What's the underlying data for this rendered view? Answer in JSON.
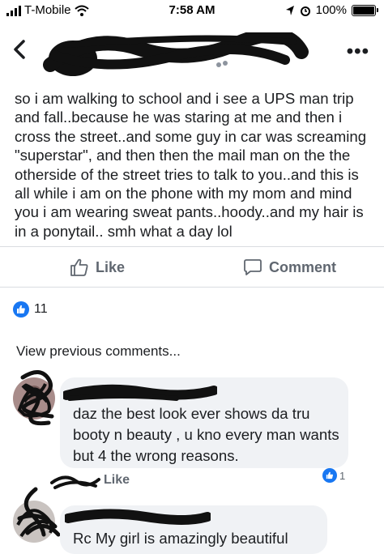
{
  "status_bar": {
    "carrier": "T-Mobile",
    "time": "7:58 AM",
    "battery": "100%"
  },
  "icons": {
    "back": "chevron-left-icon",
    "more": "more-horizontal-icon",
    "like": "thumbs-up-outline-icon",
    "comment": "comment-bubble-icon",
    "reaction": "like-badge-icon",
    "location": "location-arrow-icon",
    "alarm": "alarm-clock-icon",
    "wifi": "wifi-icon"
  },
  "colors": {
    "facebook_blue": "#1877f2",
    "text": "#1c1e21",
    "secondary": "#606770",
    "bubble": "#f0f2f5"
  },
  "header": {
    "more_label": "•••"
  },
  "post": {
    "text": "so i am walking to school and i see a UPS man trip and fall..because he was staring at me and then i cross the street..and some guy in car was screaming \"superstar\", and then then the mail man on the the otherside of the street tries to talk to you..and this is all while i am on the phone with my mom and mind you i am wearing sweat pants..hoody..and my hair is in a ponytail.. smh what a day lol",
    "like_label": "Like",
    "comment_label": "Comment",
    "reaction_count": "11",
    "view_previous": "View previous comments..."
  },
  "comments": [
    {
      "text": "daz the best look ever shows da tru booty n beauty , u kno every man wants but 4 the wrong reasons.",
      "like_label": "Like",
      "reaction_count": "1"
    },
    {
      "text": "Rc My girl is amazingly beautiful"
    }
  ]
}
